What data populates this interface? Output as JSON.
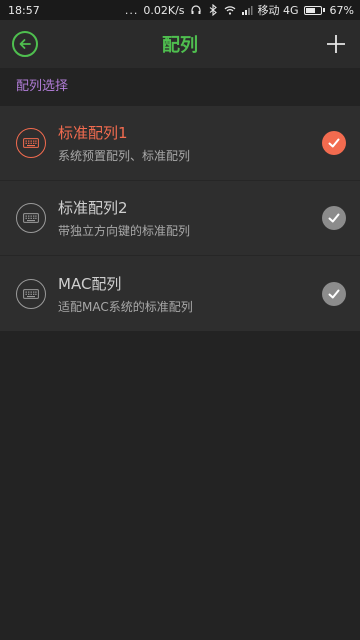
{
  "status_bar": {
    "time": "18:57",
    "dots": "...",
    "speed": "0.02K/s",
    "carrier": "移动 4G",
    "battery": "67%",
    "battery_level": 0.67
  },
  "header": {
    "title": "配列",
    "back_icon": "back-arrow-icon",
    "add_icon": "plus-icon"
  },
  "section": {
    "label": "配列选择"
  },
  "colors": {
    "accent_green": "#4fbf4f",
    "accent_orange": "#f26b4f",
    "section_purple": "#b07cd6"
  },
  "layouts": [
    {
      "title": "标准配列1",
      "description": "系统预置配列、标准配列",
      "selected": true,
      "icon": "keyboard-icon"
    },
    {
      "title": "标准配列2",
      "description": "带独立方向键的标准配列",
      "selected": false,
      "icon": "keyboard-icon"
    },
    {
      "title": "MAC配列",
      "description": "适配MAC系统的标准配列",
      "selected": false,
      "icon": "keyboard-icon"
    }
  ]
}
